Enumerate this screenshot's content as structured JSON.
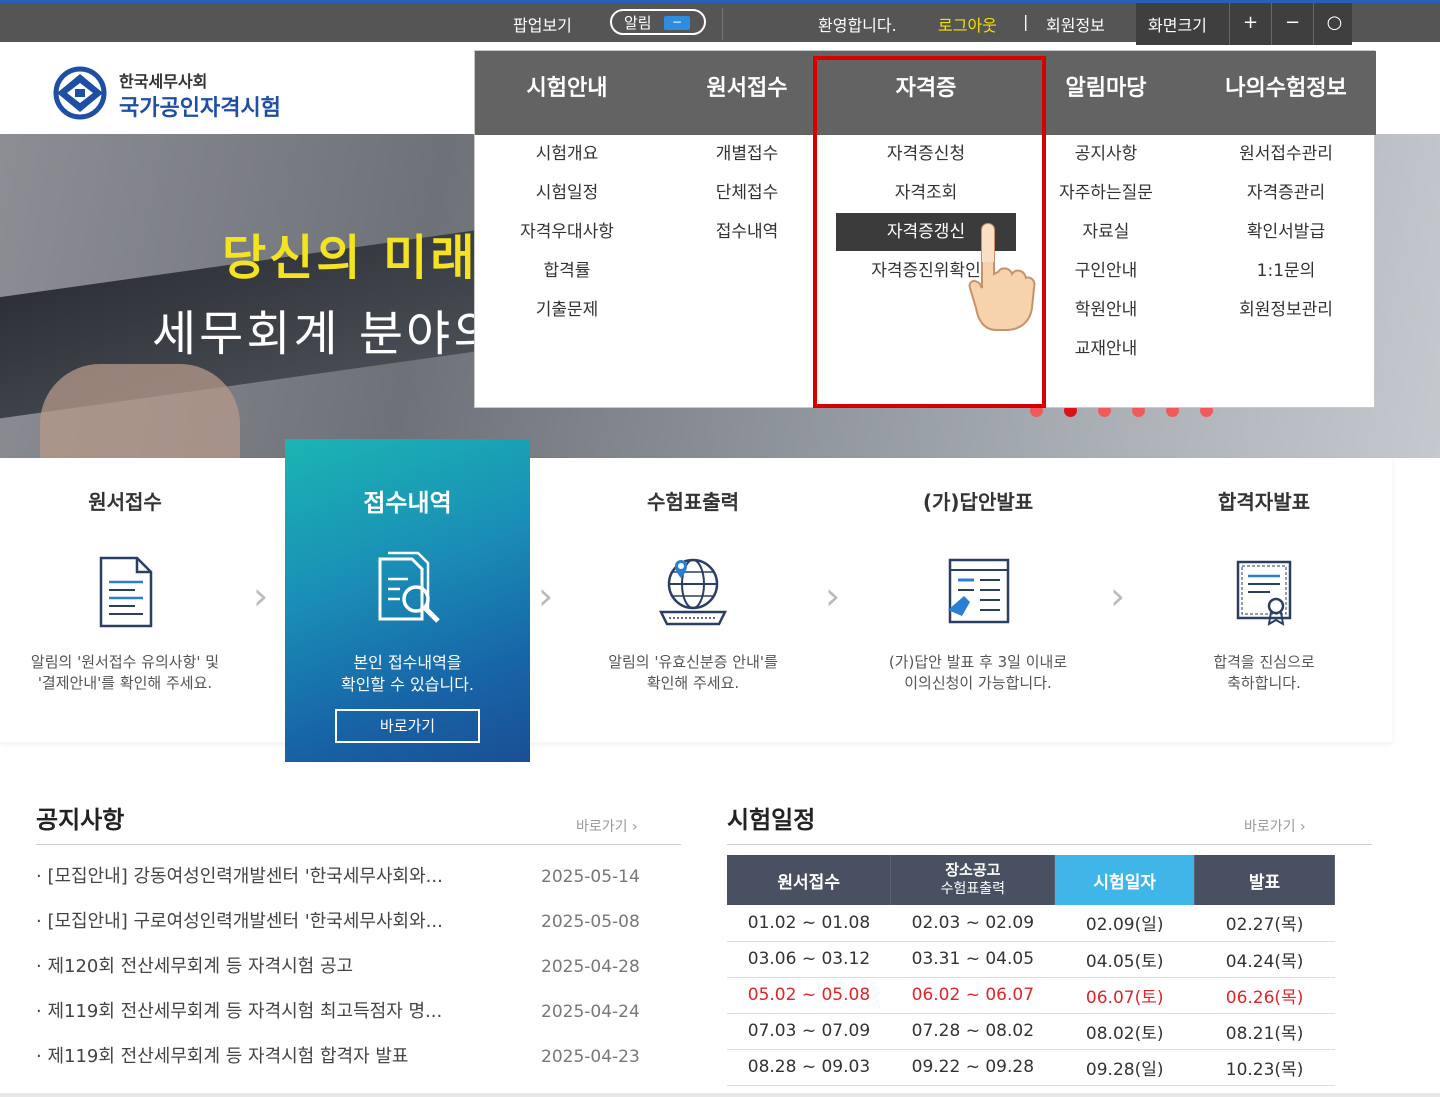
{
  "topbar": {
    "popup": "팝업보기",
    "alarm": "알림",
    "alarm_toggle": "−",
    "welcome": "환영합니다.",
    "logout": "로그아웃",
    "separator": "|",
    "member_info": "회원정보",
    "screen_size": "화면크기",
    "zoom_in": "+",
    "zoom_out": "−",
    "zoom_reset": "○"
  },
  "logo": {
    "org": "한국세무사회",
    "name": "국가공인자격시험"
  },
  "hero": {
    "line1": "당신의 미래",
    "line2": "세무회계 분야의"
  },
  "menu": [
    {
      "label": "시험안내",
      "items": [
        "시험개요",
        "시험일정",
        "자격우대사항",
        "합격률",
        "기출문제"
      ]
    },
    {
      "label": "원서접수",
      "items": [
        "개별접수",
        "단체접수",
        "접수내역"
      ]
    },
    {
      "label": "자격증",
      "items": [
        "자격증신청",
        "자격조회",
        "자격증갱신",
        "자격증진위확인"
      ]
    },
    {
      "label": "알림마당",
      "items": [
        "공지사항",
        "자주하는질문",
        "자료실",
        "구인안내",
        "학원안내",
        "교재안내"
      ]
    },
    {
      "label": "나의수험정보",
      "items": [
        "원서접수관리",
        "자격증관리",
        "확인서발급",
        "1:1문의",
        "회원정보관리"
      ]
    }
  ],
  "steps": [
    {
      "title": "원서접수",
      "desc1": "알림의 '원서접수 유의사항' 및",
      "desc2": "'결제안내'를 확인해 주세요.",
      "icon": "document-icon"
    },
    {
      "title": "접수내역",
      "desc1": "본인 접수내역을",
      "desc2": "확인할 수 있습니다.",
      "button": "바로가기",
      "icon": "document-search-icon"
    },
    {
      "title": "수험표출력",
      "desc1": "알림의 '유효신분증 안내'를",
      "desc2": "확인해 주세요.",
      "icon": "globe-keyboard-icon"
    },
    {
      "title": "(가)답안발표",
      "desc1": "(가)답안 발표 후 3일 이내로",
      "desc2": "이의신청이 가능합니다.",
      "icon": "answer-sheet-icon"
    },
    {
      "title": "합격자발표",
      "desc1": "합격을 진심으로",
      "desc2": "축하합니다.",
      "icon": "certificate-icon"
    }
  ],
  "notice": {
    "title": "공지사항",
    "more": "바로가기 ›",
    "items": [
      {
        "title": "· [모집안내] 강동여성인력개발센터 '한국세무사회와...",
        "date": "2025-05-14"
      },
      {
        "title": "· [모집안내] 구로여성인력개발센터 '한국세무사회와...",
        "date": "2025-05-08"
      },
      {
        "title": "· 제120회 전산세무회계 등 자격시험 공고",
        "date": "2025-04-28"
      },
      {
        "title": "· 제119회 전산세무회계 등 자격시험 최고득점자 명...",
        "date": "2025-04-24"
      },
      {
        "title": "· 제119회 전산세무회계 등 자격시험 합격자 발표",
        "date": "2025-04-23"
      }
    ]
  },
  "schedule": {
    "title": "시험일정",
    "more": "바로가기 ›",
    "headers": [
      "원서접수",
      "장소공고",
      "수험표출력",
      "시험일자",
      "발표"
    ],
    "rows": [
      [
        "01.02 ~ 01.08",
        "02.03 ~ 02.09",
        "02.09(일)",
        "02.27(목)"
      ],
      [
        "03.06 ~ 03.12",
        "03.31 ~ 04.05",
        "04.05(토)",
        "04.24(목)"
      ],
      [
        "05.02 ~ 05.08",
        "06.02 ~ 06.07",
        "06.07(토)",
        "06.26(목)"
      ],
      [
        "07.03 ~ 07.09",
        "07.28 ~ 08.02",
        "08.02(토)",
        "08.21(목)"
      ],
      [
        "08.28 ~ 09.03",
        "09.22 ~ 09.28",
        "09.28(일)",
        "10.23(목)"
      ]
    ]
  },
  "colors": {
    "accent_blue": "#1e4fa5",
    "menu_header": "#636363",
    "highlight_red": "#d60000",
    "hero_yellow": "#f3e321",
    "current_column": "#3fb5e8",
    "hot_row": "#e0242a"
  }
}
